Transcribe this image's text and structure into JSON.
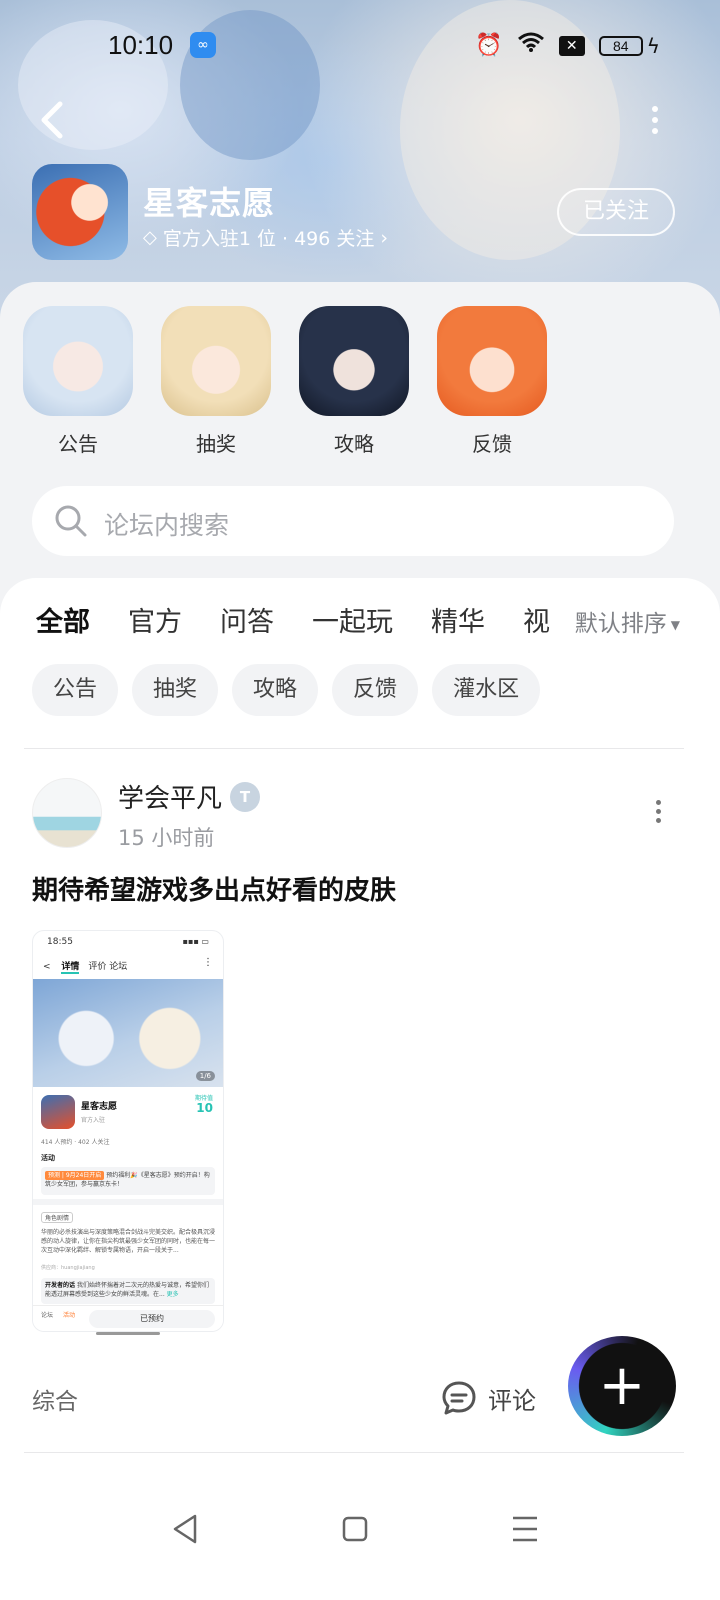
{
  "status_bar": {
    "time": "10:10",
    "battery": "84"
  },
  "forum": {
    "title": "星客志愿",
    "meta": "官方入驻1 位 · 496 关注",
    "follow_label": "已关注"
  },
  "shortcuts": [
    {
      "label": "公告"
    },
    {
      "label": "抽奖"
    },
    {
      "label": "攻略"
    },
    {
      "label": "反馈"
    }
  ],
  "search": {
    "placeholder": "论坛内搜索"
  },
  "tabs": [
    {
      "label": "全部",
      "active": true
    },
    {
      "label": "官方"
    },
    {
      "label": "问答"
    },
    {
      "label": "一起玩"
    },
    {
      "label": "精华"
    },
    {
      "label": "视"
    }
  ],
  "sort_label": "默认排序",
  "chips": [
    "公告",
    "抽奖",
    "攻略",
    "反馈",
    "灌水区"
  ],
  "post": {
    "username": "学会平凡",
    "time": "15 小时前",
    "title": "期待希望游戏多出点好看的皮肤",
    "image": {
      "status_time": "18:55",
      "nav_back": "<",
      "nav_tab_active": "详情",
      "nav_tab_2": "评价",
      "nav_tab_3": "论坛",
      "hero_page": "1/6",
      "game_name": "星客志愿",
      "game_sub": "官方入驻",
      "score_label": "期待值",
      "score": "10",
      "stats": "414 人预约 · 402 人关注",
      "activity": "活动",
      "activity_tag": "预测 | 9月24日开启",
      "activity_text": "预约福利🎉《星客志愿》预约开启！构筑少女军团，参与赢京东卡！",
      "chip": "角色剧情",
      "para": "华丽的必杀技演出与深度策略混合剑战斗完美交织。配合极具沉浸感的动人旋律，让你在指尖构筑最强少女军团的同时，也能在每一次互动中深化羁绊、解锁专属物语，开启一段关于...",
      "source": "供应商：huangjiajiang",
      "dev_title": "开发者的话",
      "dev_text": "我们始终怀揣着对二次元的热爱与诚意，希望你们能透过屏幕感受到这些少女的鲜活灵魂。在...",
      "dev_more": "更多",
      "bottom_1": "论坛",
      "bottom_2": "活动",
      "reserve": "已预约"
    },
    "footer_left": "综合",
    "comment_label": "评论"
  },
  "colors": {
    "accent": "#27c3b4",
    "sheet_bg": "#f2f3f5"
  }
}
